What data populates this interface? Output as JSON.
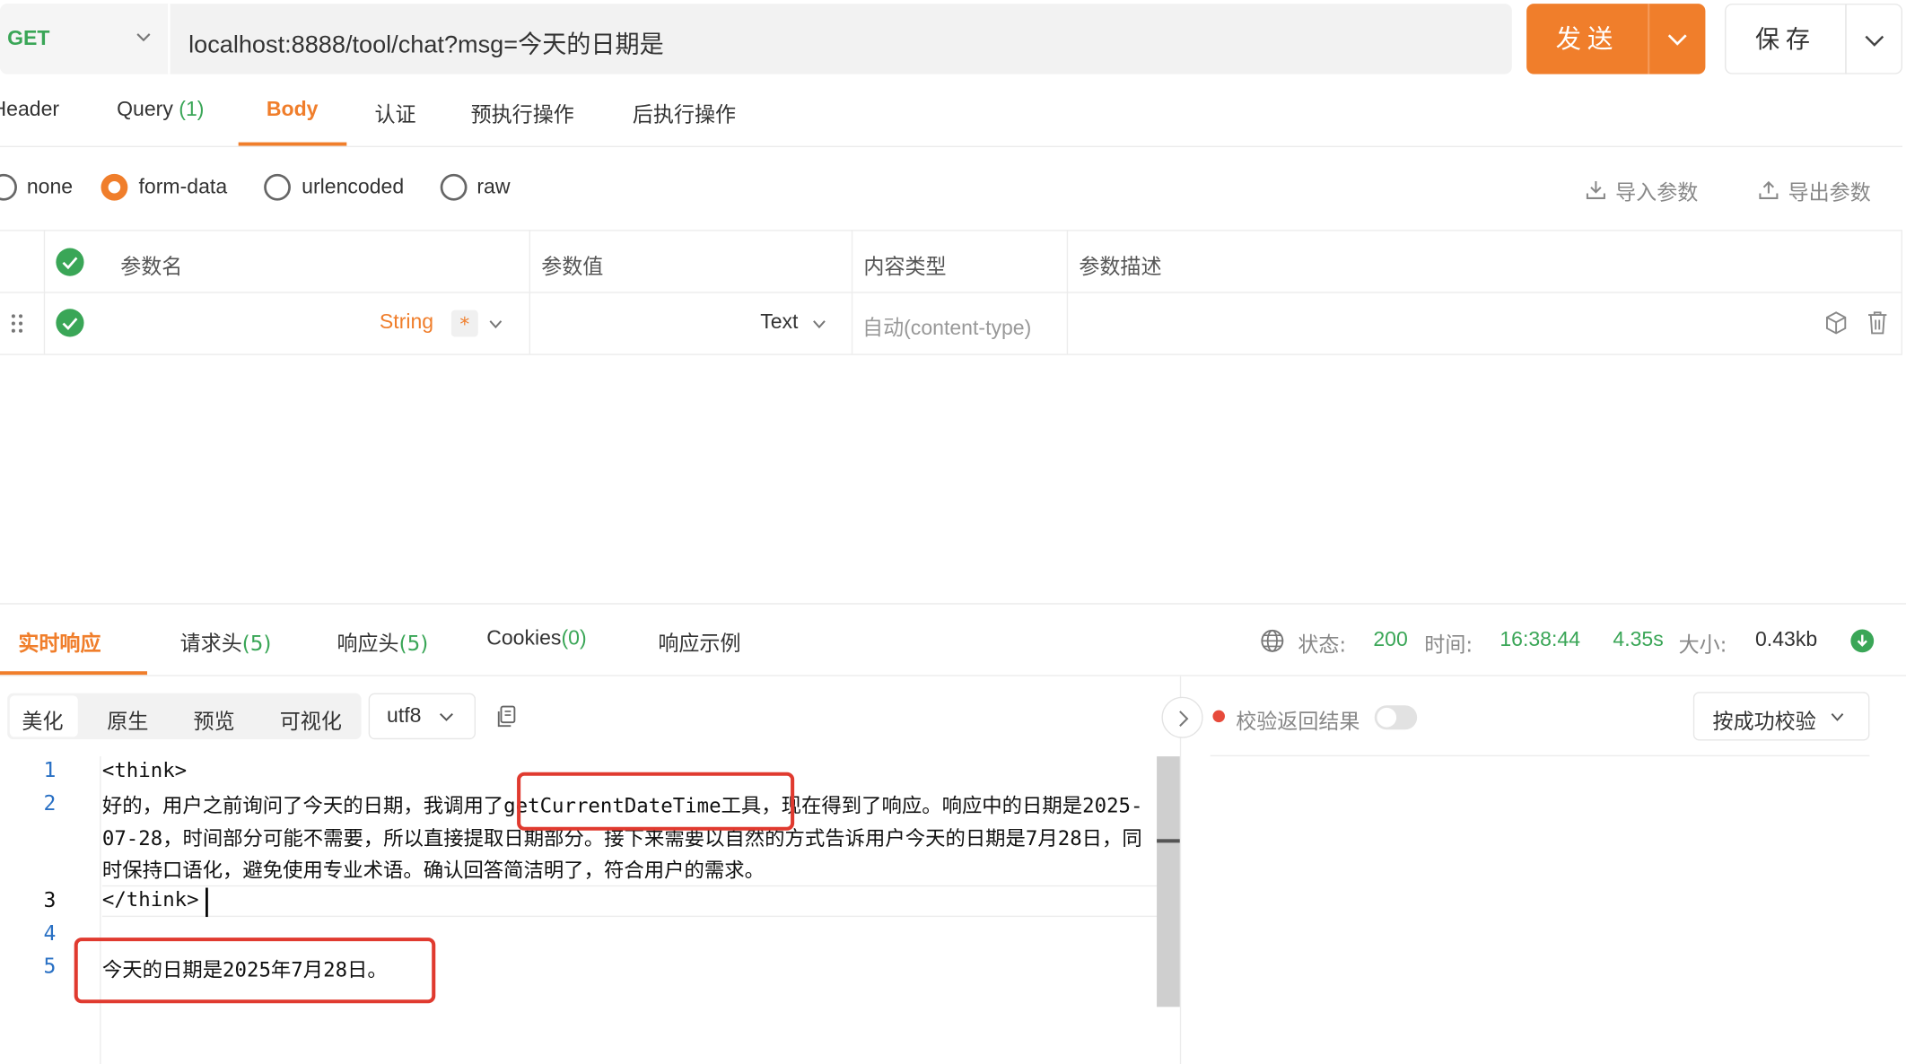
{
  "request": {
    "method": "GET",
    "url": "localhost:8888/tool/chat?msg=今天的日期是",
    "send_label": "发送",
    "save_label": "保存"
  },
  "request_tabs": [
    {
      "label": "Header",
      "count": ""
    },
    {
      "label": "Query",
      "count": "(1)"
    },
    {
      "label": "Body",
      "count": ""
    },
    {
      "label": "认证",
      "count": ""
    },
    {
      "label": "预执行操作",
      "count": ""
    },
    {
      "label": "后执行操作",
      "count": ""
    }
  ],
  "body_types": [
    "none",
    "form-data",
    "urlencoded",
    "raw"
  ],
  "body_selected": "form-data",
  "import_label": "导入参数",
  "export_label": "导出参数",
  "params_table": {
    "headers": [
      "参数名",
      "参数值",
      "内容类型",
      "参数描述"
    ],
    "row": {
      "type": "String",
      "required_mark": "*",
      "content_type": "Text",
      "content_type_placeholder": "自动(content-type)"
    }
  },
  "response_tabs": [
    {
      "label": "实时响应",
      "count": ""
    },
    {
      "label": "请求头",
      "count": "(5)"
    },
    {
      "label": "响应头",
      "count": "(5)"
    },
    {
      "label": "Cookies",
      "count": "(0)"
    },
    {
      "label": "响应示例",
      "count": ""
    }
  ],
  "status": {
    "status_label": "状态:",
    "status_code": "200",
    "time_label": "时间:",
    "time_value": "16:38:44",
    "duration": "4.35s",
    "size_label": "大小:",
    "size_value": "0.43kb"
  },
  "view_tabs": [
    "美化",
    "原生",
    "预览",
    "可视化"
  ],
  "encoding": "utf8",
  "code_lines": [
    {
      "no": "1",
      "text": "<think>"
    },
    {
      "no": "2",
      "text": "好的，用户之前询问了今天的日期，我调用了getCurrentDateTime工具，现在得到了响应。响应中的日期是2025-07-28，时间部分可能不需要，所以直接提取日期部分。接下来需要以自然的方式告诉用户今天的日期是7月28日，同时保持口语化，避免使用专业术语。确认回答简洁明了，符合用户的需求。"
    },
    {
      "no": "3",
      "text": "</think>"
    },
    {
      "no": "4",
      "text": ""
    },
    {
      "no": "5",
      "text": "今天的日期是2025年7月28日。"
    }
  ],
  "validation": {
    "label": "校验返回结果",
    "mode": "按成功校验"
  },
  "colors": {
    "accent": "#f07e2b",
    "success": "#3aa657",
    "annotation": "#e03a2f"
  }
}
